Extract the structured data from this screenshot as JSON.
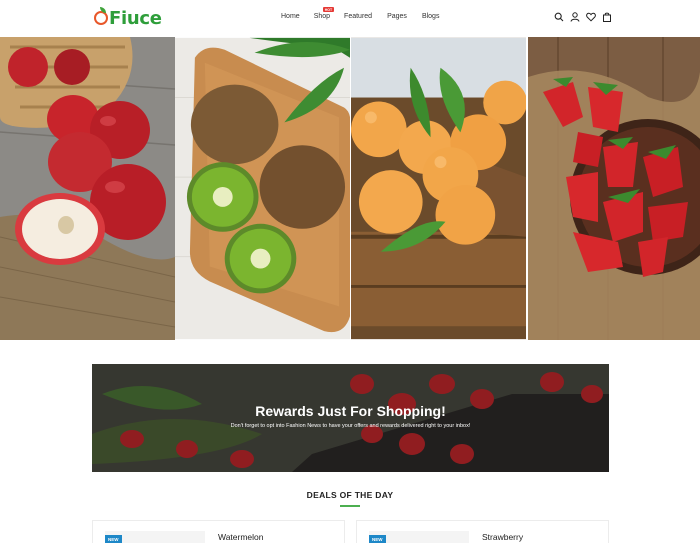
{
  "header": {
    "logo_text": "Fiuce",
    "nav": [
      {
        "label": "Home"
      },
      {
        "label": "Shop",
        "badge": "HOT"
      },
      {
        "label": "Featured"
      },
      {
        "label": "Pages"
      },
      {
        "label": "Blogs"
      }
    ],
    "icons": [
      "search-icon",
      "user-icon",
      "heart-icon",
      "bag-icon"
    ]
  },
  "hero": {
    "panels": [
      "apples",
      "kiwi",
      "apricots",
      "strawberries"
    ]
  },
  "banner": {
    "title": "Rewards Just For Shopping!",
    "subtitle": "Don't forget to opt into Fashion News to have your offers and rewards delivered right to your inbox!"
  },
  "deals": {
    "title": "DEALS OF THE DAY",
    "accent_color": "#4caf50",
    "cards": [
      {
        "badge": "NEW",
        "name": "Watermelon"
      },
      {
        "badge": "NEW",
        "name": "Strawberry"
      }
    ]
  },
  "colors": {
    "brand_green": "#2e9e3a",
    "brand_orange": "#e8572a",
    "hot_badge": "#e53935",
    "new_badge": "#1e88c8"
  }
}
